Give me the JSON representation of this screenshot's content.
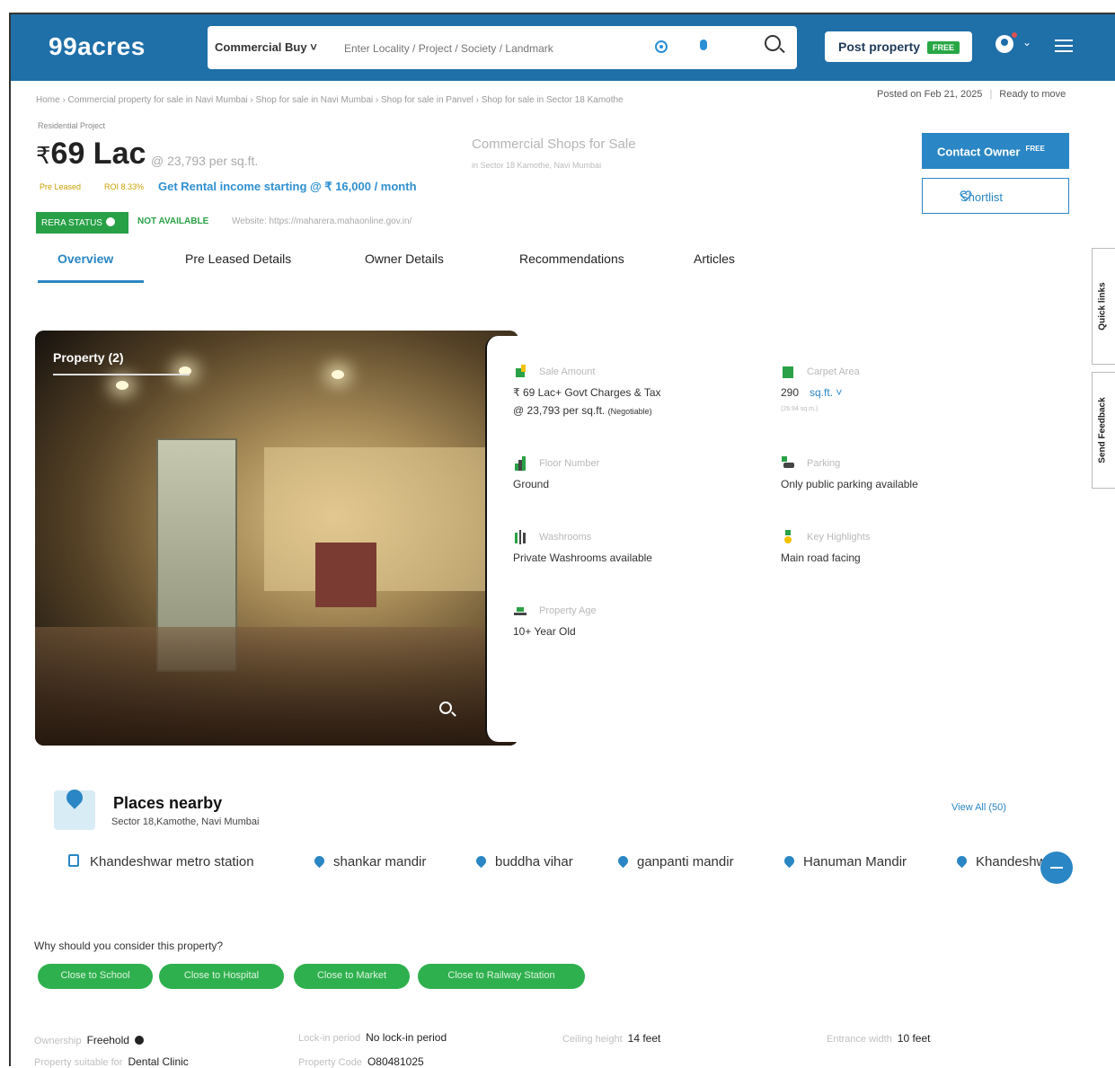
{
  "header": {
    "logo": "99acres",
    "search_category": "Commercial Buy ˅",
    "search_placeholder": "Enter Locality / Project / Society / Landmark",
    "post_property_label": "Post property",
    "post_property_tag": "FREE"
  },
  "breadcrumb": "Home › Commercial property for sale in Navi Mumbai › Shop for sale in Navi Mumbai › Shop for sale in Panvel › Shop for sale in Sector 18 Kamothe",
  "posted": {
    "date": "Posted on Feb 21, 2025",
    "status": "Ready to move"
  },
  "listing": {
    "project_tag": "Residential Project",
    "price": "69 Lac",
    "currency": "₹",
    "per_sqft": "@ 23,793 per sq.ft.",
    "title": "Commercial Shops for Sale",
    "location_sub": "in Sector 18 Kamothe, Navi Mumbai",
    "pre_leased": "Pre Leased",
    "roi": "ROI 8.33%",
    "rental_income": "Get Rental income starting @ ₹ 16,000 / month",
    "rera_status": "RERA STATUS",
    "rera_value": "NOT AVAILABLE",
    "website": "Website: https://maharera.mahaonline.gov.in/"
  },
  "actions": {
    "contact_owner": "Contact Owner",
    "contact_owner_tag": "FREE",
    "shortlist": "Shortlist"
  },
  "tabs": [
    "Overview",
    "Pre Leased Details",
    "Owner Details",
    "Recommendations",
    "Articles"
  ],
  "gallery": {
    "title": "Property (2)"
  },
  "details": {
    "sale_amount_label": "Sale Amount",
    "sale_amount_value": "₹ 69 Lac+ Govt Charges & Tax",
    "sale_amount_sub": "@ 23,793 per sq.ft.",
    "sale_amount_note": "(Negotiable)",
    "carpet_area_label": "Carpet Area",
    "carpet_area_value": "290",
    "carpet_area_unit": "sq.ft. ˅",
    "carpet_area_note": "(26.94 sq.m.)",
    "floor_label": "Floor Number",
    "floor_value": "Ground",
    "parking_label": "Parking",
    "parking_value": "Only public parking available",
    "washrooms_label": "Washrooms",
    "washrooms_value": "Private Washrooms available",
    "highlights_label": "Key Highlights",
    "highlights_value": "Main road facing",
    "age_label": "Property Age",
    "age_value": "10+ Year Old"
  },
  "nearby": {
    "title": "Places nearby",
    "subtitle": "Sector 18,Kamothe, Navi Mumbai",
    "view_all": "View All (50)",
    "places": [
      "Khandeshwar metro station",
      "shankar mandir",
      "buddha vihar",
      "ganpanti mandir",
      "Hanuman Mandir",
      "Khandeshwar"
    ]
  },
  "why": {
    "question": "Why should you consider this property?",
    "reasons": [
      "Close to School",
      "Close to Hospital",
      "Close to Market",
      "Close to Railway Station"
    ]
  },
  "info": {
    "ownership_label": "Ownership",
    "ownership_value": "Freehold",
    "lockin_label": "Lock-in period",
    "lockin_value": "No lock-in period",
    "ceiling_label": "Ceiling height",
    "ceiling_value": "14 feet",
    "entrance_label": "Entrance width",
    "entrance_value": "10 feet",
    "suitable_label": "Property suitable for",
    "suitable_value": "Dental Clinic",
    "code_label": "Property Code",
    "code_value": "O80481025"
  },
  "side": {
    "quick_links": "Quick links",
    "feedback": "Send Feedback"
  },
  "colors": {
    "brand_blue": "#1f6fa8",
    "accent_blue": "#2a86c4",
    "green": "#27a046"
  }
}
